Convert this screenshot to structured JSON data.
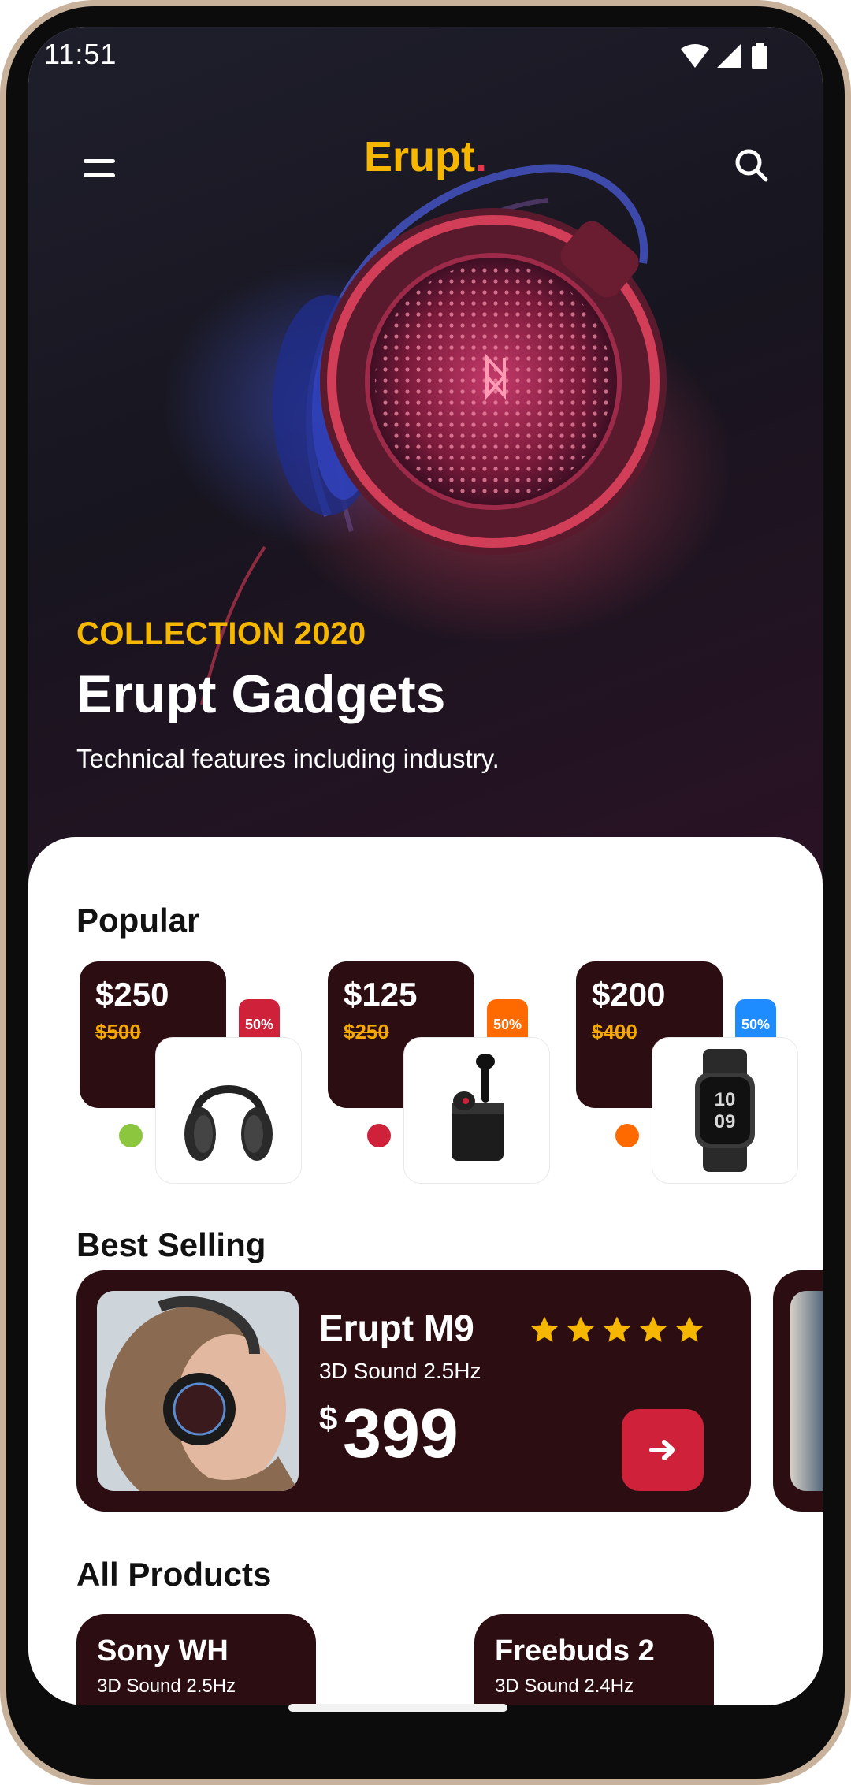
{
  "status_bar": {
    "time": "11:51"
  },
  "header": {
    "brand": "Erupt",
    "brand_dot": "."
  },
  "hero": {
    "eyebrow": "COLLECTION 2020",
    "title": "Erupt Gadgets",
    "subtitle": "Technical features including industry."
  },
  "popular": {
    "title": "Popular",
    "items": [
      {
        "price": "$250",
        "old_price": "$500",
        "badge": "50%",
        "badge_color": "#d0213b",
        "dot_color": "#8cc63f",
        "icon": "headphones-icon"
      },
      {
        "price": "$125",
        "old_price": "$250",
        "badge": "50%",
        "badge_color": "#ff6a00",
        "dot_color": "#d0213b",
        "icon": "earbuds-icon"
      },
      {
        "price": "$200",
        "old_price": "$400",
        "badge": "50%",
        "badge_color": "#1e8cff",
        "dot_color": "#ff6a00",
        "icon": "smartwatch-icon"
      }
    ]
  },
  "best_selling": {
    "title": "Best Selling",
    "card": {
      "name": "Erupt M9",
      "subtitle": "3D Sound 2.5Hz",
      "currency": "$",
      "price": "399",
      "rating": 5
    }
  },
  "all_products": {
    "title": "All Products",
    "items": [
      {
        "name": "Sony WH",
        "subtitle": "3D Sound 2.5Hz"
      },
      {
        "name": "Freebuds 2",
        "subtitle": "3D Sound 2.4Hz"
      }
    ]
  },
  "colors": {
    "brand": "#f5b700",
    "accent": "#d0213b",
    "card": "#2c0d12"
  }
}
